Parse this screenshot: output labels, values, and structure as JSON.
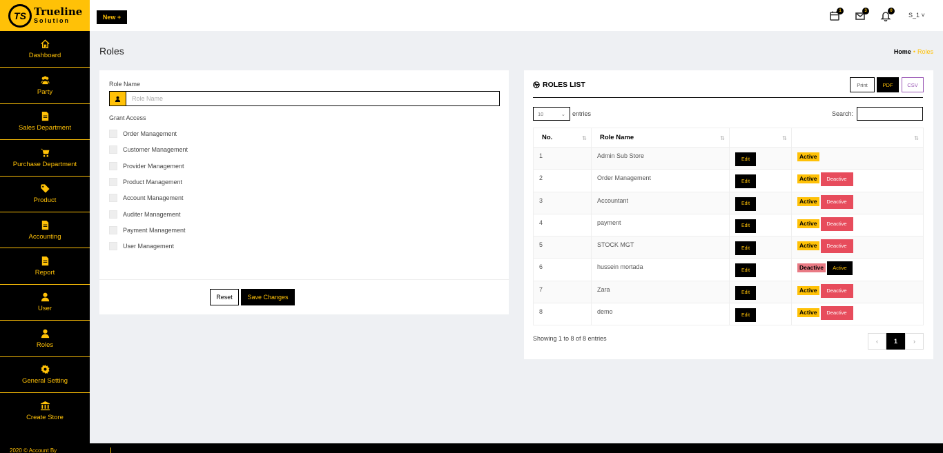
{
  "brand": {
    "logo_mark": "TS",
    "name_line1": "Trueline",
    "name_line2": "Solution"
  },
  "sidebar": {
    "items": [
      {
        "label": "Dashboard",
        "icon": "home-icon"
      },
      {
        "label": "Party",
        "icon": "users-icon"
      },
      {
        "label": "Sales Department",
        "icon": "file-icon"
      },
      {
        "label": "Purchase Department",
        "icon": "cart-icon"
      },
      {
        "label": "Product",
        "icon": "tag-icon"
      },
      {
        "label": "Accounting",
        "icon": "file-icon"
      },
      {
        "label": "Report",
        "icon": "file-icon"
      },
      {
        "label": "User",
        "icon": "user-icon"
      },
      {
        "label": "Roles",
        "icon": "user-icon"
      },
      {
        "label": "General Setting",
        "icon": "gear-icon"
      },
      {
        "label": "Create Store",
        "icon": "bank-icon"
      }
    ]
  },
  "topbar": {
    "new_label": "New +",
    "calendar_count": "1",
    "mail_count": "3",
    "bell_count": "0",
    "user": "S_1 ˅"
  },
  "page": {
    "title": "Roles",
    "breadcrumb_home": "Home",
    "breadcrumb_sep": "•",
    "breadcrumb_current": "Roles"
  },
  "form": {
    "role_name_label": "Role Name",
    "role_name_placeholder": "Role Name",
    "grant_access_label": "Grant Access",
    "permissions": [
      "Order Management",
      "Customer Management",
      "Provider Management",
      "Product Management",
      "Account Management",
      "Auditer Management",
      "Payment Management",
      "User Management"
    ],
    "reset_label": "Reset",
    "save_label": "Save Changes"
  },
  "list": {
    "title": "ROLES LIST",
    "print_label": "Print",
    "pdf_label": "PDF",
    "csv_label": "CSV",
    "length_value": "10",
    "entries_label": "entries",
    "search_label": "Search:",
    "columns": [
      "No.",
      "Role Name",
      "",
      ""
    ],
    "rows": [
      {
        "no": "1",
        "name": "Admin Sub Store",
        "edit": "Edit",
        "status": "Active",
        "action": ""
      },
      {
        "no": "2",
        "name": "Order Management",
        "edit": "Edit",
        "status": "Active",
        "action": "Deactive"
      },
      {
        "no": "3",
        "name": "Accountant",
        "edit": "Edit",
        "status": "Active",
        "action": "Deactive"
      },
      {
        "no": "4",
        "name": "payment",
        "edit": "Edit",
        "status": "Active",
        "action": "Deactive"
      },
      {
        "no": "5",
        "name": "STOCK MGT",
        "edit": "Edit",
        "status": "Active",
        "action": "Deactive"
      },
      {
        "no": "6",
        "name": "hussein mortada",
        "edit": "Edit",
        "status": "Deactive",
        "action": "Active"
      },
      {
        "no": "7",
        "name": "Zara",
        "edit": "Edit",
        "status": "Active",
        "action": "Deactive"
      },
      {
        "no": "8",
        "name": "demo",
        "edit": "Edit",
        "status": "Active",
        "action": "Deactive"
      }
    ],
    "info": "Showing 1 to 8 of 8 entries",
    "prev": "‹",
    "page": "1",
    "next": "›"
  },
  "footer": {
    "text": "2020 © Account By"
  },
  "colors": {
    "accent": "#ffc107",
    "sidebar_bg": "#000000",
    "danger": "#e74c5c"
  }
}
